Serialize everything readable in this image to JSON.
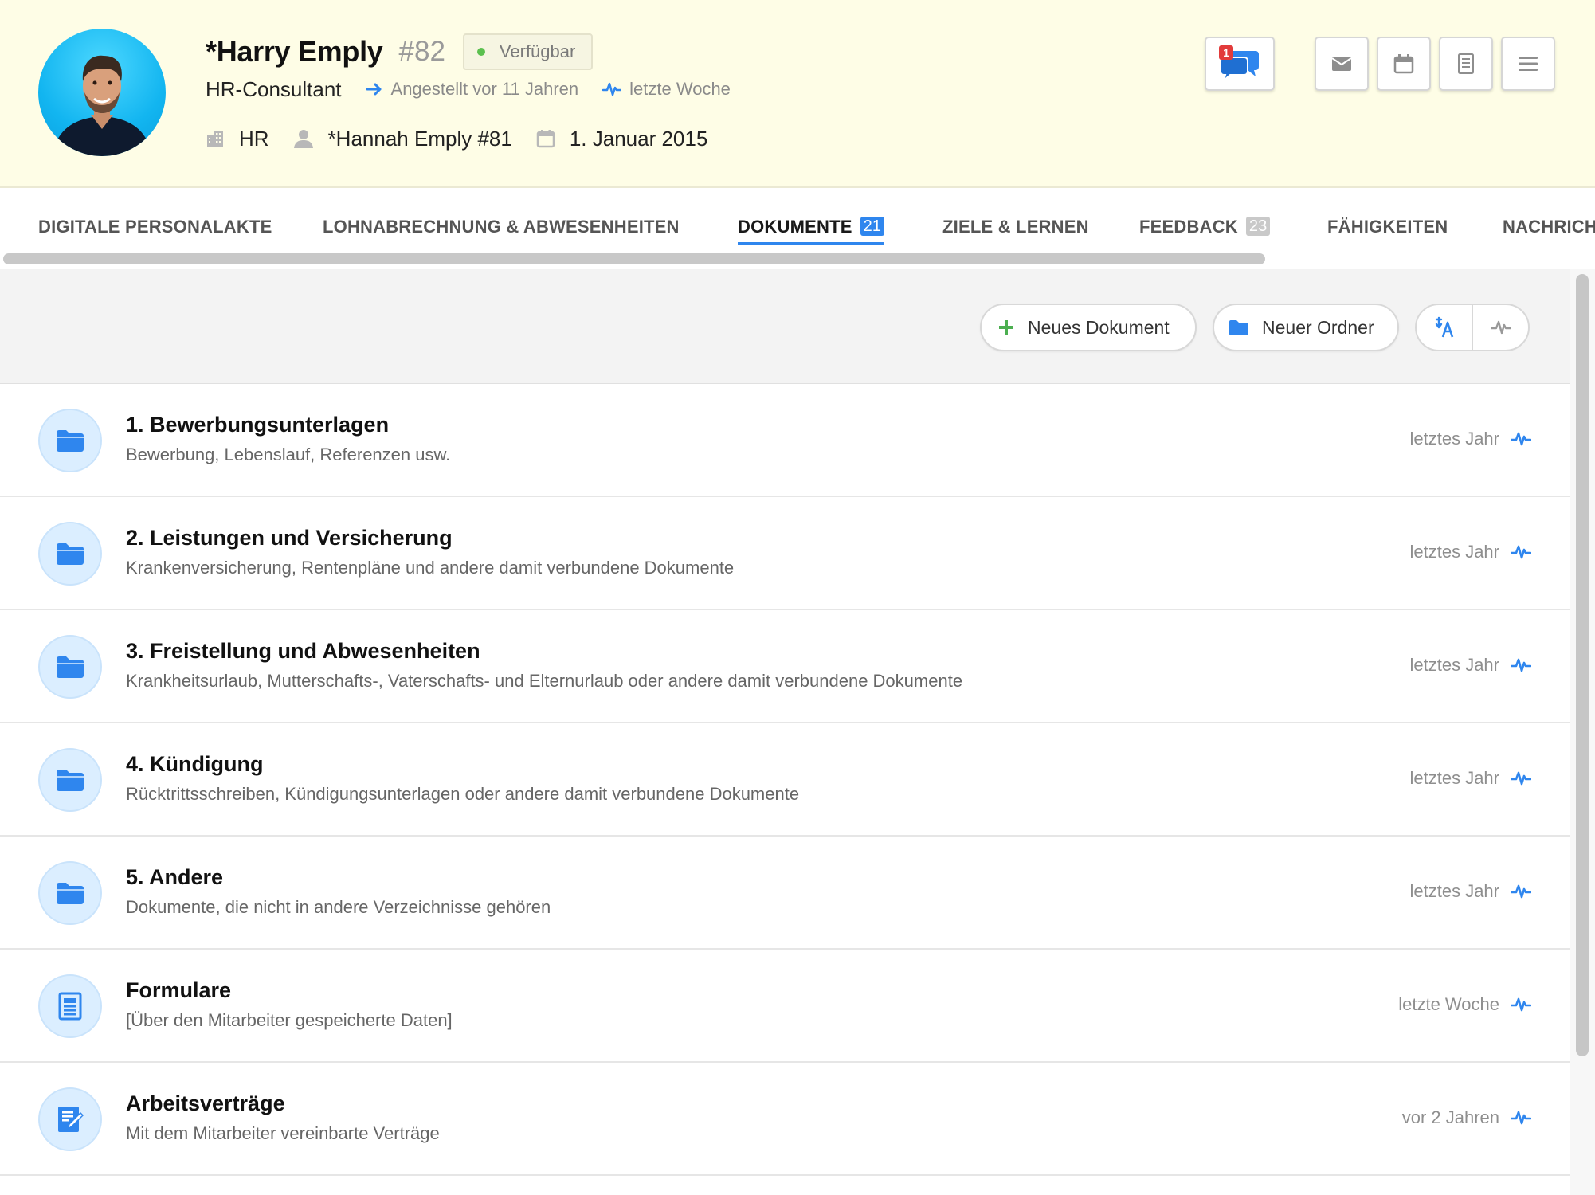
{
  "employee": {
    "name": "*Harry Emply",
    "id": "#82",
    "status": "Verfügbar",
    "job_title": "HR-Consultant",
    "hired": "Angestellt vor 11 Jahren",
    "last_activity": "letzte Woche",
    "department": "HR",
    "manager": "*Hannah Emply #81",
    "start_date": "1. Januar 2015"
  },
  "header_actions": {
    "chat_badge": "1",
    "icons": [
      "chat-icon",
      "mail-icon",
      "calendar-icon",
      "document-icon",
      "menu-icon"
    ]
  },
  "tabs": [
    {
      "label": "DIGITALE PERSONALAKTE",
      "count": ""
    },
    {
      "label": "LOHNABRECHNUNG & ABWESENHEITEN",
      "count": ""
    },
    {
      "label": "DOKUMENTE",
      "count": "21"
    },
    {
      "label": "ZIELE & LERNEN",
      "count": ""
    },
    {
      "label": "FEEDBACK",
      "count": "23"
    },
    {
      "label": "FÄHIGKEITEN",
      "count": ""
    },
    {
      "label": "NACHRICH",
      "count": ""
    }
  ],
  "active_tab": "DOKUMENTE",
  "toolbar": {
    "new_document": "Neues Dokument",
    "new_folder": "Neuer Ordner"
  },
  "documents": [
    {
      "icon": "folder-icon",
      "title": "1. Bewerbungsunterlagen",
      "desc": "Bewerbung, Lebenslauf, Referenzen usw.",
      "time": "letztes Jahr"
    },
    {
      "icon": "folder-icon",
      "title": "2. Leistungen und Versicherung",
      "desc": "Krankenversicherung, Rentenpläne und andere damit verbundene Dokumente",
      "time": "letztes Jahr"
    },
    {
      "icon": "folder-icon",
      "title": "3. Freistellung und Abwesenheiten",
      "desc": "Krankheitsurlaub, Mutterschafts-, Vaterschafts- und Elternurlaub oder andere damit verbundene Dokumente",
      "time": "letztes Jahr"
    },
    {
      "icon": "folder-icon",
      "title": "4. Kündigung",
      "desc": "Rücktrittsschreiben, Kündigungsunterlagen oder andere damit verbundene Dokumente",
      "time": "letztes Jahr"
    },
    {
      "icon": "folder-icon",
      "title": "5. Andere",
      "desc": "Dokumente, die nicht in andere Verzeichnisse gehören",
      "time": "letztes Jahr"
    },
    {
      "icon": "form-icon",
      "title": "Formulare",
      "desc": "[Über den Mitarbeiter gespeicherte Daten]",
      "time": "letzte Woche"
    },
    {
      "icon": "contract-icon",
      "title": "Arbeitsverträge",
      "desc": "Mit dem Mitarbeiter vereinbarte Verträge",
      "time": "vor 2 Jahren"
    }
  ],
  "colors": {
    "header_bg": "#fefde6",
    "accent": "#2f86ee",
    "status_green": "#5bc04f",
    "badge_red": "#e23b3b",
    "add_green": "#4caf50"
  }
}
